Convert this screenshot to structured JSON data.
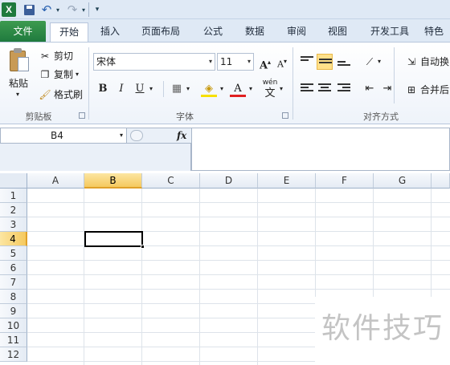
{
  "quick_access": {
    "app_icon": "excel-logo-icon",
    "logo_text": "X",
    "icons": [
      "save-icon",
      "undo-icon",
      "redo-icon",
      "customize-icon"
    ]
  },
  "tabs": [
    {
      "label": "文件"
    },
    {
      "label": "开始"
    },
    {
      "label": "插入"
    },
    {
      "label": "页面布局"
    },
    {
      "label": "公式"
    },
    {
      "label": "数据"
    },
    {
      "label": "审阅"
    },
    {
      "label": "视图"
    },
    {
      "label": "开发工具"
    },
    {
      "label": "特色"
    }
  ],
  "ribbon": {
    "clipboard": {
      "paste_label": "粘贴",
      "cut_label": "剪切",
      "copy_label": "复制",
      "format_painter_label": "格式刷",
      "group_label": "剪贴板"
    },
    "font": {
      "font_name": "宋体",
      "font_size": "11",
      "grow_label": "A",
      "shrink_label": "A",
      "bold_label": "B",
      "italic_label": "I",
      "underline_label": "U",
      "font_color_label": "A",
      "phonetic_top": "wén",
      "phonetic_bottom": "文",
      "group_label": "字体"
    },
    "alignment": {
      "wrap_label": "自动换",
      "merge_label": "合并后",
      "group_label": "对齐方式"
    }
  },
  "formula_bar": {
    "name_box": "B4",
    "fx_label": "fx",
    "formula": ""
  },
  "grid": {
    "columns": [
      "A",
      "B",
      "C",
      "D",
      "E",
      "F",
      "G"
    ],
    "rows": [
      "1",
      "2",
      "3",
      "4",
      "5",
      "6",
      "7",
      "8",
      "9",
      "10",
      "11",
      "12"
    ],
    "selected_column": "B",
    "selected_row": "4"
  },
  "watermark": {
    "text": "软件技巧"
  },
  "colors": {
    "file_tab": "#1f7a3e",
    "selection_header": "#f5c95e",
    "ribbon_bg": "#eef3fa"
  }
}
